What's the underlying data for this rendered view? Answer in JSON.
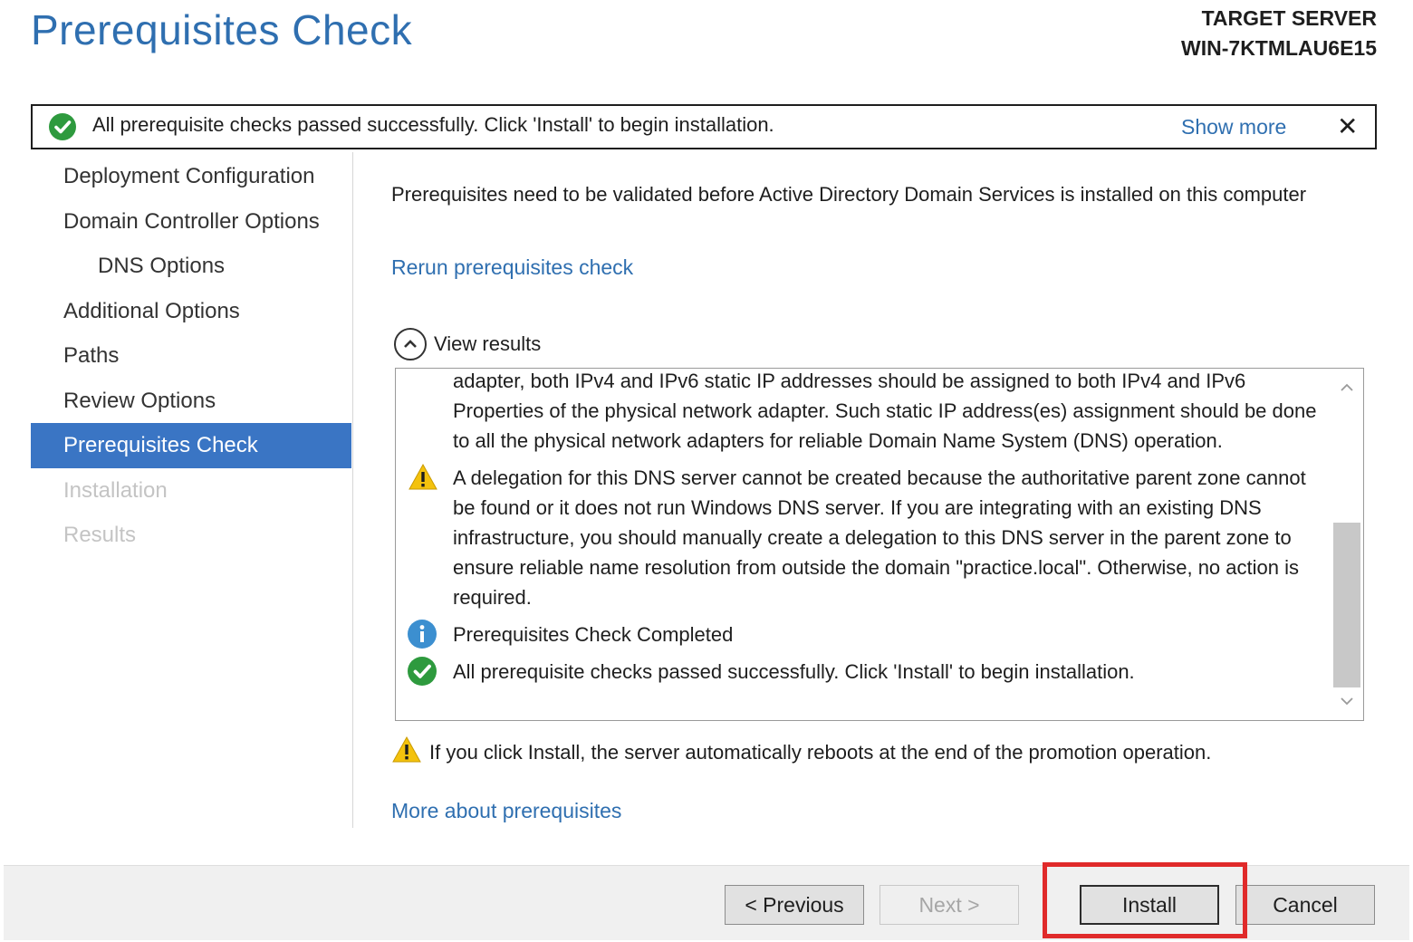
{
  "window": {
    "title": "Prerequisites Check",
    "target_server_label": "TARGET SERVER",
    "target_server_name": "WIN-7KTMLAU6E15"
  },
  "banner": {
    "message": "All prerequisite checks passed successfully.  Click 'Install' to begin installation.",
    "show_more": "Show more",
    "close_symbol": "✕"
  },
  "nav": {
    "items": [
      {
        "label": "Deployment Configuration"
      },
      {
        "label": "Domain Controller Options"
      },
      {
        "label": "DNS Options"
      },
      {
        "label": "Additional Options"
      },
      {
        "label": "Paths"
      },
      {
        "label": "Review Options"
      },
      {
        "label": "Prerequisites Check"
      },
      {
        "label": "Installation"
      },
      {
        "label": "Results"
      }
    ]
  },
  "main": {
    "intro": "Prerequisites need to be validated before Active Directory Domain Services is installed on this computer",
    "rerun_link": "Rerun prerequisites check",
    "view_results": "View results",
    "results": [
      {
        "icon": "none",
        "text": "adapter, both IPv4 and IPv6 static IP addresses should be assigned to both IPv4 and IPv6 Properties of the physical network adapter. Such static IP address(es) assignment should be done to all the physical network adapters for reliable Domain Name System (DNS) operation."
      },
      {
        "icon": "warning-icon",
        "text": "A delegation for this DNS server cannot be created because the authoritative parent zone cannot be found or it does not run Windows DNS server. If you are integrating with an existing DNS infrastructure, you should manually create a delegation to this DNS server in the parent zone to ensure reliable name resolution from outside the domain \"practice.local\". Otherwise, no action is required."
      },
      {
        "icon": "info-icon",
        "text": "Prerequisites Check Completed"
      },
      {
        "icon": "success-check-icon",
        "text": "All prerequisite checks passed successfully.  Click 'Install' to begin installation."
      }
    ],
    "reboot_warning": "If you click Install, the server automatically reboots at the end of the promotion operation.",
    "more_link": "More about prerequisites"
  },
  "footer": {
    "previous": "< Previous",
    "next": "Next >",
    "install": "Install",
    "cancel": "Cancel"
  },
  "colors": {
    "accent": "#2f6fb0",
    "nav_active": "#3a75c4",
    "success": "#2e9a3e",
    "warning": "#f4c20d",
    "info": "#3c8fd0",
    "highlight": "#e02a2a"
  }
}
